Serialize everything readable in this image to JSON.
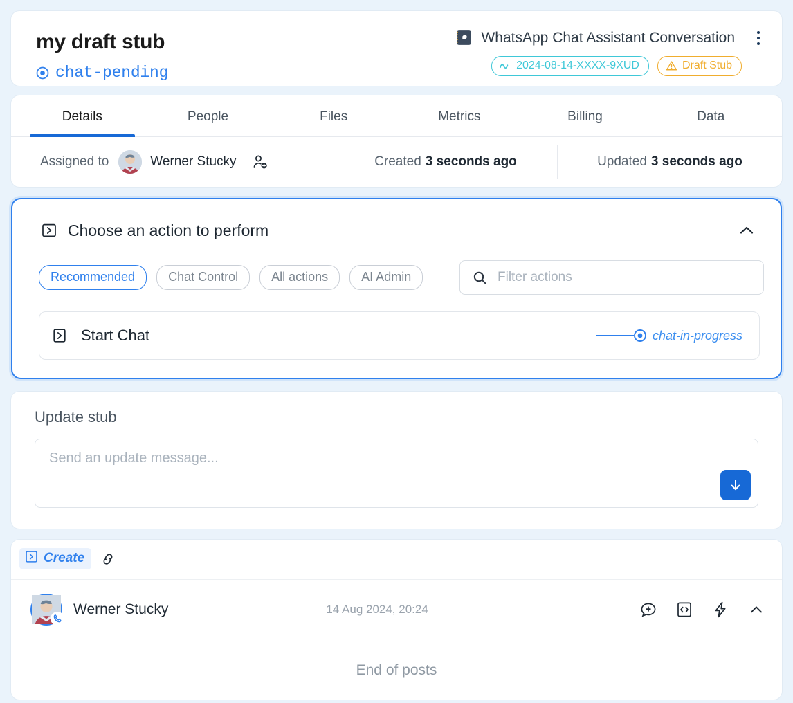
{
  "header": {
    "title": "my draft stub",
    "status": "chat-pending",
    "status_icon": "target-dot-icon",
    "subject": "WhatsApp Chat Assistant Conversation",
    "subject_icon": "whatsapp-app-icon",
    "menu_icon": "kebab-menu-icon",
    "badges": [
      {
        "label": "2024-08-14-XXXX-9XUD",
        "icon": "wave-icon",
        "color": "#3fc8d8",
        "name": "reference-badge"
      },
      {
        "label": "Draft Stub",
        "icon": "warning-triangle-icon",
        "color": "#f0ad2e",
        "name": "draft-stub-badge"
      }
    ]
  },
  "tabs": [
    {
      "label": "Details",
      "active": true
    },
    {
      "label": "People",
      "active": false
    },
    {
      "label": "Files",
      "active": false
    },
    {
      "label": "Metrics",
      "active": false
    },
    {
      "label": "Billing",
      "active": false
    },
    {
      "label": "Data",
      "active": false
    }
  ],
  "meta": {
    "assigned_label": "Assigned to",
    "assignee": "Werner Stucky",
    "add_person_icon": "add-person-icon",
    "created_label": "Created",
    "created_value": "3 seconds ago",
    "updated_label": "Updated",
    "updated_value": "3 seconds ago"
  },
  "action_panel": {
    "title": "Choose an action to perform",
    "title_icon": "boxed-arrow-icon",
    "collapse_icon": "chevron-up-icon",
    "chips": [
      {
        "label": "Recommended",
        "active": true
      },
      {
        "label": "Chat Control",
        "active": false
      },
      {
        "label": "All actions",
        "active": false
      },
      {
        "label": "AI Admin",
        "active": false
      }
    ],
    "filter": {
      "placeholder": "Filter actions",
      "value": "",
      "icon": "search-icon"
    },
    "actions": [
      {
        "label": "Start Chat",
        "icon": "boxed-arrow-icon",
        "result_state": "chat-in-progress"
      }
    ]
  },
  "update_stub": {
    "title": "Update stub",
    "placeholder": "Send an update message...",
    "value": "",
    "send_icon": "arrow-down-icon"
  },
  "posts": {
    "create_tag": "Create",
    "create_tag_icon": "boxed-arrow-icon",
    "link_icon": "link-icon",
    "entries": [
      {
        "author": "Werner Stucky",
        "timestamp": "14 Aug 2024, 20:24",
        "icons": [
          "message-plus-icon",
          "code-block-icon",
          "lightning-icon",
          "chevron-up-icon"
        ]
      }
    ],
    "end_text": "End of posts"
  },
  "colors": {
    "page_background": "#eaf3fb",
    "accent_blue": "#2f80ed",
    "active_tab_blue": "#1769d6",
    "teal": "#3fc8d8",
    "amber": "#f0ad2e"
  }
}
